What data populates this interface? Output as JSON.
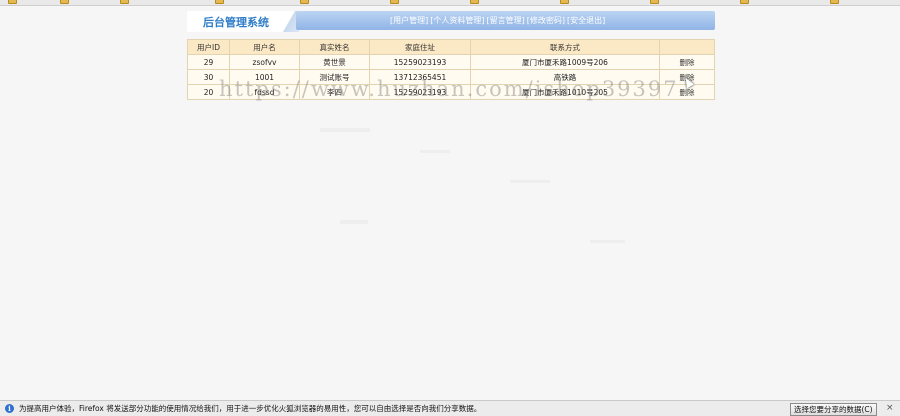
{
  "header": {
    "logo_text": "后台管理系统",
    "nav": [
      "[用户管理]",
      "[个人资料管理]",
      "[留言管理]",
      "[修改密码]",
      "[安全退出]"
    ]
  },
  "table": {
    "columns": [
      "用户ID",
      "用户名",
      "真实姓名",
      "家庭住址",
      "联系方式",
      ""
    ],
    "rows": [
      {
        "id": "29",
        "username": "zsofvv",
        "realname": "黄世景",
        "address": "15259023193",
        "contact": "厦门市厦禾路1009号206",
        "action": "删除"
      },
      {
        "id": "30",
        "username": "1001",
        "realname": "测试账号",
        "address": "13712365451",
        "contact": "高铁路",
        "action": "删除"
      },
      {
        "id": "20",
        "username": "fdssd",
        "realname": "李四",
        "address": "15259023193",
        "contact": "厦门市厦禾路1010号205",
        "action": "删除"
      }
    ]
  },
  "watermark": "https://www.huzhan.com/ishop39397",
  "notification": {
    "text": "为提高用户体验，Firefox 将发送部分功能的使用情况给我们，用于进一步优化火狐浏览器的易用性，您可以自由选择是否向我们分享数据。",
    "button": "选择您要分享的数据(C)",
    "close": "×"
  },
  "colors": {
    "accent": "#2f7dc8",
    "nav_bg": "#9dbde9",
    "table_header_bg": "#fbe8c4",
    "table_row_bg": "#fffbf0"
  }
}
